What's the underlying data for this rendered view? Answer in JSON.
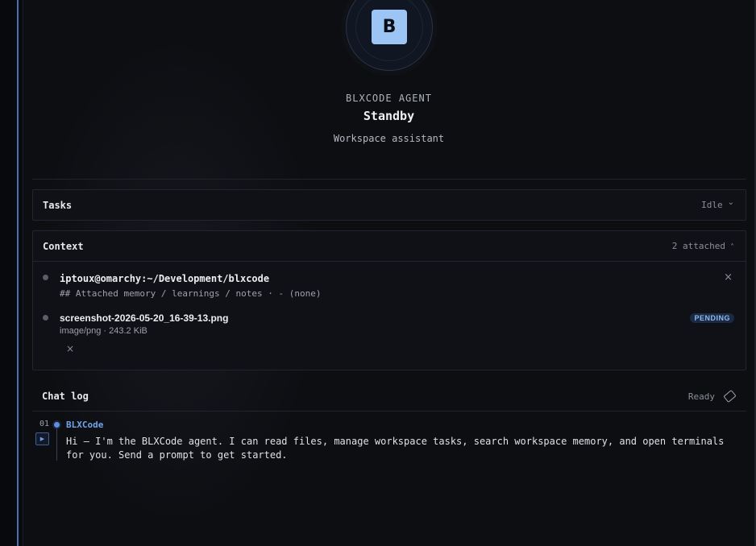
{
  "agent": {
    "avatar_letter": "B",
    "label": "BLXCODE AGENT",
    "status": "Standby",
    "subtitle": "Workspace assistant"
  },
  "tasks": {
    "title": "Tasks",
    "status": "Idle",
    "chevron": "⌄"
  },
  "context": {
    "title": "Context",
    "count_label": "2 attached",
    "chevron": "˄",
    "items": [
      {
        "title": "iptoux@omarchy:~/Development/blxcode",
        "subtitle": "## Attached memory / learnings / notes · - (none)",
        "close": "×"
      },
      {
        "title": "screenshot-2026-05-20_16-39-13.png",
        "subtitle": "image/png · 243.2 KiB",
        "badge": "PENDING",
        "close": "×"
      }
    ]
  },
  "chat": {
    "title": "Chat log",
    "status": "Ready",
    "messages": [
      {
        "number": "01",
        "play": "▶",
        "author": "BLXCode",
        "text": "Hi — I'm the BLXCode agent. I can read files, manage workspace tasks, search workspace memory, and open terminals for you. Send a prompt to get started."
      }
    ]
  },
  "colors": {
    "accent": "#72a4ec",
    "avatar_tile": "#9cc5f5",
    "rail": "#4b6fb3",
    "background": "#0d0e12"
  }
}
